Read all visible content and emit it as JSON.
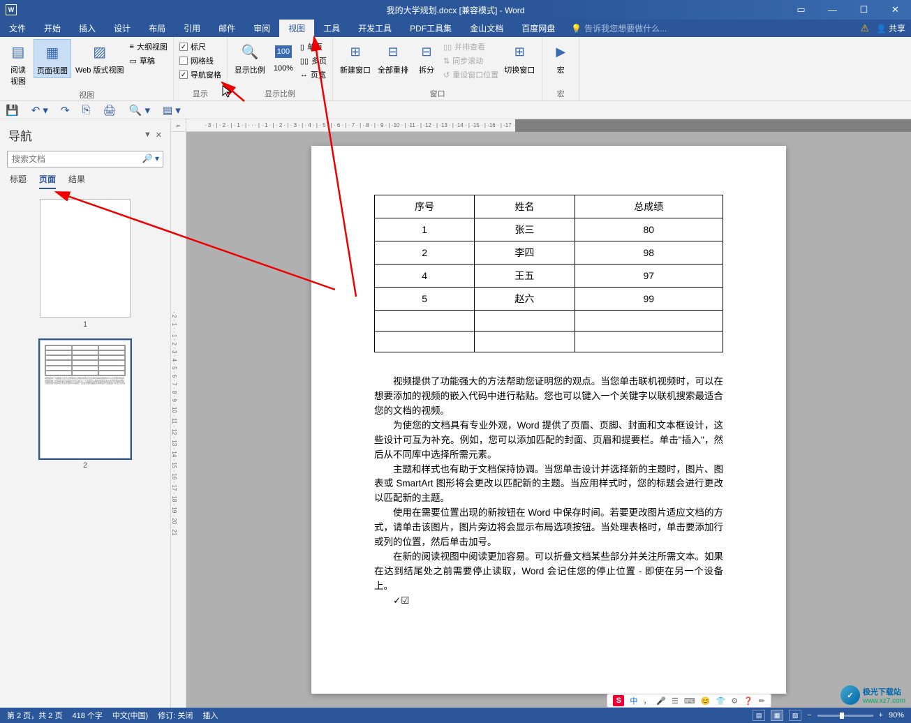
{
  "titlebar": {
    "title": "我的大学规划.docx [兼容模式] - Word"
  },
  "menubar": {
    "items": [
      "文件",
      "开始",
      "插入",
      "设计",
      "布局",
      "引用",
      "邮件",
      "审阅",
      "视图",
      "工具",
      "开发工具",
      "PDF工具集",
      "金山文档",
      "百度网盘"
    ],
    "active_index": 8,
    "tell_me": "告诉我您想要做什么...",
    "share": "共享"
  },
  "ribbon": {
    "view_group": {
      "read": "阅读\n视图",
      "page": "页面视图",
      "web": "Web 版式视图",
      "outline": "大纲视图",
      "draft": "草稿",
      "label": "视图"
    },
    "show_group": {
      "ruler": "标尺",
      "gridlines": "网格线",
      "navpane": "导航窗格",
      "label": "显示"
    },
    "zoom_group": {
      "zoom": "显示比例",
      "hundred": "100%",
      "onepage": "单页",
      "multipage": "多页",
      "pagewidth": "页宽",
      "label": "显示比例"
    },
    "window_group": {
      "newwin": "新建窗口",
      "arrange": "全部重排",
      "split": "拆分",
      "sidebyside": "并排查看",
      "syncscroll": "同步滚动",
      "resetpos": "重设窗口位置",
      "switch": "切换窗口",
      "label": "窗口"
    },
    "macro_group": {
      "macro": "宏",
      "label": "宏"
    }
  },
  "navpane": {
    "title": "导航",
    "search_placeholder": "搜索文档",
    "tabs": [
      "标题",
      "页面",
      "结果"
    ],
    "active_tab": 1,
    "thumbs": [
      "1",
      "2"
    ]
  },
  "document": {
    "table": {
      "headers": [
        "序号",
        "姓名",
        "总成绩"
      ],
      "rows": [
        [
          "1",
          "张三",
          "80"
        ],
        [
          "2",
          "李四",
          "98"
        ],
        [
          "4",
          "王五",
          "97"
        ],
        [
          "5",
          "赵六",
          "99"
        ],
        [
          "",
          "",
          ""
        ],
        [
          "",
          "",
          ""
        ]
      ]
    },
    "paragraphs": [
      "视频提供了功能强大的方法帮助您证明您的观点。当您单击联机视频时，可以在想要添加的视频的嵌入代码中进行粘贴。您也可以键入一个关键字以联机搜索最适合您的文档的视频。",
      "为使您的文档具有专业外观，Word 提供了页眉、页脚、封面和文本框设计，这些设计可互为补充。例如，您可以添加匹配的封面、页眉和提要栏。单击\"插入\"，然后从不同库中选择所需元素。",
      "主题和样式也有助于文档保持协调。当您单击设计并选择新的主题时，图片、图表或 SmartArt 图形将会更改以匹配新的主题。当应用样式时，您的标题会进行更改以匹配新的主题。",
      "使用在需要位置出现的新按钮在 Word 中保存时间。若要更改图片适应文档的方式，请单击该图片，图片旁边将会显示布局选项按钮。当处理表格时，单击要添加行或列的位置，然后单击加号。",
      "在新的阅读视图中阅读更加容易。可以折叠文档某些部分并关注所需文本。如果在达到结尾处之前需要停止读取，Word 会记住您的停止位置 - 即使在另一个设备上。"
    ],
    "checkbox_line": "✓☑"
  },
  "statusbar": {
    "page": "第 2 页，共 2 页",
    "words": "418 个字",
    "lang": "中文(中国)",
    "track": "修订: 关闭",
    "insert": "插入",
    "zoom": "90%"
  },
  "ime": {
    "label": "中",
    "icons": [
      "，",
      "🎤",
      "☰",
      "⌨",
      "😊",
      "👕",
      "⚙",
      "❓",
      "✏"
    ]
  },
  "watermark": {
    "brand": "极光下载站",
    "url": "www.xz7.com"
  },
  "ruler": {
    "h": "· 3 · | · 2 · | · 1 · | · · · | · 1 · | · 2 · | · 3 · | · 4 · | · 5 · | · 6 · | · 7 · | · 8 · | · 9 · | ·10 · | ·11 · | ·12 · | ·13 · | ·14 · | ·15 · | ·16 · | ·17 ·",
    "v": "· 2 · 1 · · 1 · 2 · 3 · 4 · 5 · 6 · 7 · 8 · 9 · 10 · 11 · 12 · 13 · 14 · 15 · 16 · 17 · 18 · 19 · 20 · 21"
  }
}
